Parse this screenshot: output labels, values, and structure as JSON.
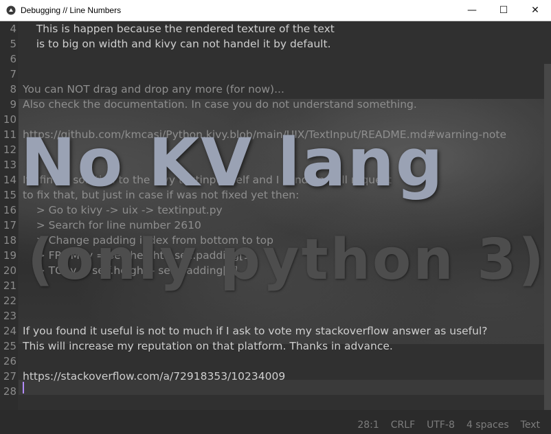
{
  "window": {
    "title": "Debugging // Line Numbers",
    "controls": {
      "minimize": "—",
      "maximize": "☐",
      "close": "✕"
    }
  },
  "editor": {
    "lines": [
      {
        "num": "4",
        "text": "    This is happen because the rendered texture of the text",
        "dim": false
      },
      {
        "num": "5",
        "text": "    is to big on width and kivy can not handel it by default.",
        "dim": false
      },
      {
        "num": "6",
        "text": "",
        "dim": false
      },
      {
        "num": "7",
        "text": "",
        "dim": false
      },
      {
        "num": "8",
        "text": "You can NOT drag and drop any more (for now)...",
        "dim": true
      },
      {
        "num": "9",
        "text": "Also check the documentation. In case you do not understand something.",
        "dim": true
      },
      {
        "num": "10",
        "text": "",
        "dim": true
      },
      {
        "num": "11",
        "text": "https://github.com/kmcasi/Python.kivy.blob/main/UIX/TextInput/README.md#warning-note",
        "dim": true
      },
      {
        "num": "12",
        "text": "",
        "dim": true
      },
      {
        "num": "13",
        "text": "",
        "dim": true
      },
      {
        "num": "14",
        "text": "If I find a solution to the kivy textinput self and I send an pull request",
        "dim": true
      },
      {
        "num": "15",
        "text": "to fix that, but just in case if was not fixed yet then:",
        "dim": true
      },
      {
        "num": "16",
        "text": "    > Go to kivy -> uix -> textinput.py",
        "dim": true
      },
      {
        "num": "17",
        "text": "    > Search for line number 2610",
        "dim": true
      },
      {
        "num": "18",
        "text": "    > Change padding index from bottom to top",
        "dim": true
      },
      {
        "num": "19",
        "text": "    > FROM: y = self.height - self.padding[1]",
        "dim": true
      },
      {
        "num": "20",
        "text": "    > TO: y = self.height - self.padding[3]",
        "dim": true
      },
      {
        "num": "21",
        "text": "",
        "dim": true
      },
      {
        "num": "22",
        "text": "",
        "dim": true
      },
      {
        "num": "23",
        "text": "",
        "dim": true
      },
      {
        "num": "24",
        "text": "If you found it useful is not to much if I ask to vote my stackoverflow answer as useful?",
        "dim": false
      },
      {
        "num": "25",
        "text": "This will increase my reputation on that platform. Thanks in advance.",
        "dim": false
      },
      {
        "num": "26",
        "text": "",
        "dim": false
      },
      {
        "num": "27",
        "text": "https://stackoverflow.com/a/72918353/10234009",
        "dim": false
      },
      {
        "num": "28",
        "text": "",
        "dim": false
      }
    ]
  },
  "overlay": {
    "headline": "No KV lang",
    "subline": "(only python 3)"
  },
  "statusbar": {
    "position": "28:1",
    "line_ending": "CRLF",
    "encoding": "UTF-8",
    "indent": "4 spaces",
    "syntax": "Text"
  },
  "colors": {
    "caret": "#b38cff",
    "headline": "#9aa2b4",
    "background": "#303030"
  }
}
